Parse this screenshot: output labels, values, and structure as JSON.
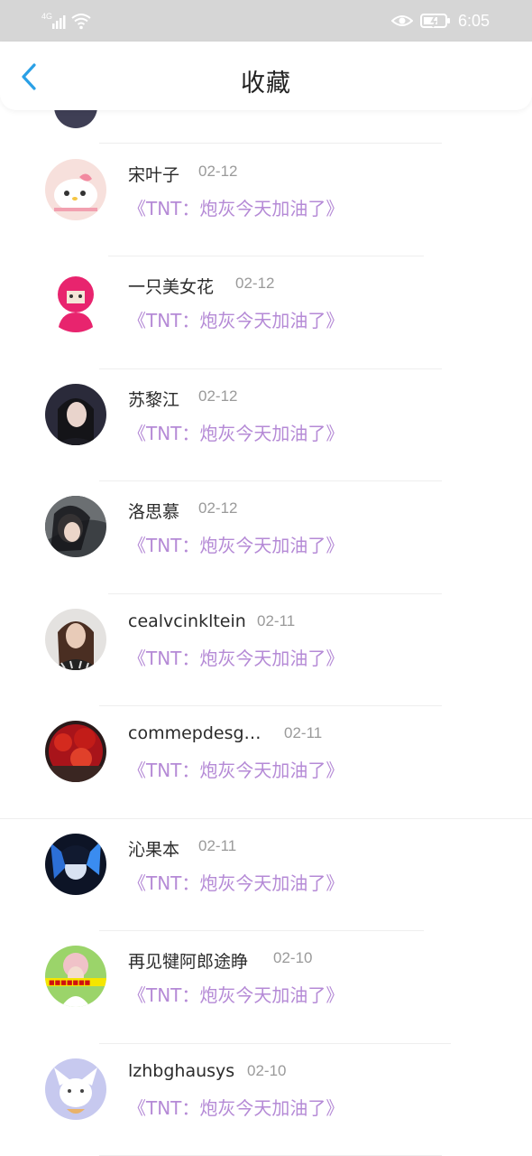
{
  "status_bar": {
    "network": "4G",
    "time": "6:05",
    "icons": [
      "signal-icon",
      "wifi-icon",
      "eye-icon",
      "battery-icon"
    ]
  },
  "header": {
    "back_icon": "chevron-left-icon",
    "title": "收藏"
  },
  "colors": {
    "accent_back": "#2aa0e6",
    "work_title": "#b58ad6",
    "date_gray": "#9a9a9a",
    "status_bar_bg": "#d6d6d6"
  },
  "favorites": [
    {
      "name": "宋叶子",
      "date": "02-12",
      "work": "《TNT：炮灰今天加油了》"
    },
    {
      "name": "一只美女花",
      "date": "02-12",
      "work": "《TNT：炮灰今天加油了》"
    },
    {
      "name": "苏黎江",
      "date": "02-12",
      "work": "《TNT：炮灰今天加油了》"
    },
    {
      "name": "洛思慕",
      "date": "02-12",
      "work": "《TNT：炮灰今天加油了》"
    },
    {
      "name": "cealvcinkltein",
      "date": "02-11",
      "work": "《TNT：炮灰今天加油了》"
    },
    {
      "name": "commepdesg…",
      "date": "02-11",
      "work": "《TNT：炮灰今天加油了》"
    },
    {
      "name": "沁果本",
      "date": "02-11",
      "work": "《TNT：炮灰今天加油了》"
    },
    {
      "name": "再见犍阿郎途睁",
      "date": "02-10",
      "work": "《TNT：炮灰今天加油了》"
    },
    {
      "name": "lzhbghausys",
      "date": "02-10",
      "work": "《TNT：炮灰今天加油了》"
    }
  ]
}
